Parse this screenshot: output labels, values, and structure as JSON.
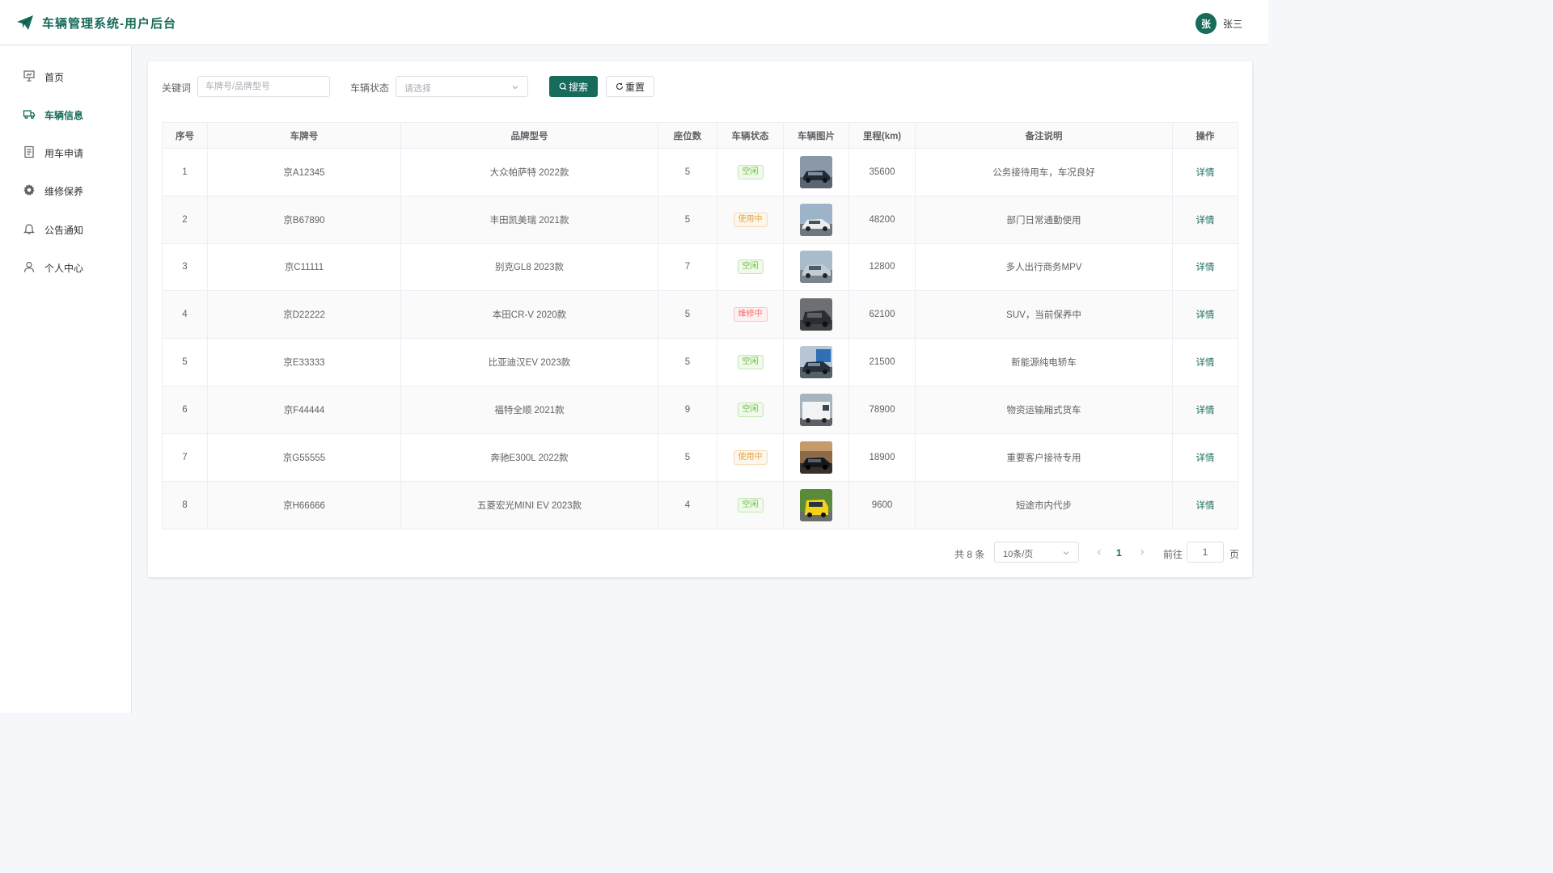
{
  "header": {
    "app_title": "车辆管理系统-用户后台",
    "user_avatar_text": "张",
    "user_name": "张三",
    "brand_color": "#176b5b"
  },
  "sidebar": {
    "items": [
      {
        "label": "首页",
        "icon": "presentation-icon",
        "active": false
      },
      {
        "label": "车辆信息",
        "icon": "truck-icon",
        "active": true
      },
      {
        "label": "用车申请",
        "icon": "document-icon",
        "active": false
      },
      {
        "label": "维修保养",
        "icon": "gear-icon",
        "active": false
      },
      {
        "label": "公告通知",
        "icon": "bell-icon",
        "active": false
      },
      {
        "label": "个人中心",
        "icon": "user-icon",
        "active": false
      }
    ]
  },
  "filters": {
    "keyword_label": "关键词",
    "keyword_placeholder": "车牌号/品牌型号",
    "keyword_value": "",
    "status_label": "车辆状态",
    "status_placeholder": "请选择",
    "search_button": "搜索",
    "reset_button": "重置"
  },
  "table": {
    "columns": [
      "序号",
      "车牌号",
      "品牌型号",
      "座位数",
      "车辆状态",
      "车辆图片",
      "里程(km)",
      "备注说明",
      "操作"
    ],
    "action_label": "详情",
    "rows": [
      {
        "index": "1",
        "plate": "京A12345",
        "model": "大众帕萨特 2022款",
        "seats": "5",
        "status": "空闲",
        "status_type": "free",
        "image": "car-photo-dark-sedan",
        "mileage": "35600",
        "note": "公务接待用车，车况良好"
      },
      {
        "index": "2",
        "plate": "京B67890",
        "model": "丰田凯美瑞 2021款",
        "seats": "5",
        "status": "使用中",
        "status_type": "use",
        "image": "car-photo-white-sedan",
        "mileage": "48200",
        "note": "部门日常通勤使用"
      },
      {
        "index": "3",
        "plate": "京C11111",
        "model": "别克GL8 2023款",
        "seats": "7",
        "status": "空闲",
        "status_type": "free",
        "image": "car-photo-silver-car",
        "mileage": "12800",
        "note": "多人出行商务MPV"
      },
      {
        "index": "4",
        "plate": "京D22222",
        "model": "本田CR-V 2020款",
        "seats": "5",
        "status": "维修中",
        "status_type": "fix",
        "image": "car-photo-dark-suv",
        "mileage": "62100",
        "note": "SUV，当前保养中"
      },
      {
        "index": "5",
        "plate": "京E33333",
        "model": "比亚迪汉EV 2023款",
        "seats": "5",
        "status": "空闲",
        "status_type": "free",
        "image": "car-photo-charging-ev",
        "mileage": "21500",
        "note": "新能源纯电轿车"
      },
      {
        "index": "6",
        "plate": "京F44444",
        "model": "福特全顺 2021款",
        "seats": "9",
        "status": "空闲",
        "status_type": "free",
        "image": "car-photo-white-van",
        "mileage": "78900",
        "note": "物资运输厢式货车"
      },
      {
        "index": "7",
        "plate": "京G55555",
        "model": "奔驰E300L 2022款",
        "seats": "5",
        "status": "使用中",
        "status_type": "use",
        "image": "car-photo-showroom-sedan",
        "mileage": "18900",
        "note": "重要客户接待专用"
      },
      {
        "index": "8",
        "plate": "京H66666",
        "model": "五菱宏光MINI EV 2023款",
        "seats": "4",
        "status": "空闲",
        "status_type": "free",
        "image": "car-photo-yellow-mini",
        "mileage": "9600",
        "note": "短途市内代步"
      }
    ]
  },
  "pagination": {
    "total_text": "共 8 条",
    "page_size": "10条/页",
    "current_page": "1",
    "goto_label": "前往",
    "goto_value": "1",
    "page_unit": "页"
  }
}
